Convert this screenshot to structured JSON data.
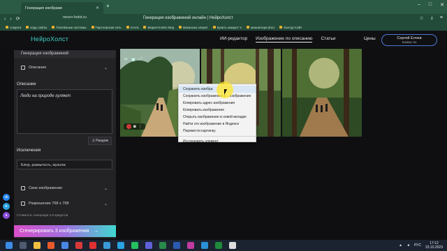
{
  "browser": {
    "tab_title": "Генерация изображе",
    "url": "neuro-holst.ru",
    "page_title": "Генерация изображений онлайн | НейроХолст",
    "bookmarks": [
      "сократи",
      "коды сайты",
      "Платёжные системы",
      "Партнерская сеть",
      "почта",
      "Маркетплейс Мед",
      "Вакансии операт",
      "Купить аккаунт V",
      "миниатюра.docx",
      "Контур.Сайт"
    ]
  },
  "site": {
    "logo": "НейроХолст",
    "nav": [
      "ИИ-редактор",
      "Изображение по описанию",
      "Статьи"
    ],
    "prices": "Цены",
    "user_name": "Сергей Елчев",
    "user_credits": "Кэнвас 91"
  },
  "sidebar": {
    "header": "Генерация изображений",
    "mode": "Описание",
    "desc_label": "Описание",
    "desc_value": "Люди на природе гуляют",
    "random_label": "Рандом",
    "excl_label": "Исключения",
    "excl_value": "Блюр, размытость, мультик",
    "own_image": "Свое изображение",
    "resolution": "Разрешение 768 x 768",
    "cost_note": "Стоимость генерации 4,8 кредитов",
    "generate_label": "Сгенерировать 3 изображения"
  },
  "context_menu": [
    "Сохранить изобра",
    "Сохранить изображение и... изображение",
    "Копировать адрес изображения",
    "Копировать изображение",
    "Открыть изображение в новой вкладке",
    "Найти это изображение в Яндексе",
    "Перевести картинку",
    "Исследовать элемент"
  ],
  "taskbar": {
    "lang": "РУС",
    "time": "17:12",
    "date": "23.10.2023"
  },
  "colors": {
    "accent": "#3fd1c4",
    "brand_gradient_start": "#d94fc8",
    "brand_gradient_end": "#3fd8d0"
  }
}
